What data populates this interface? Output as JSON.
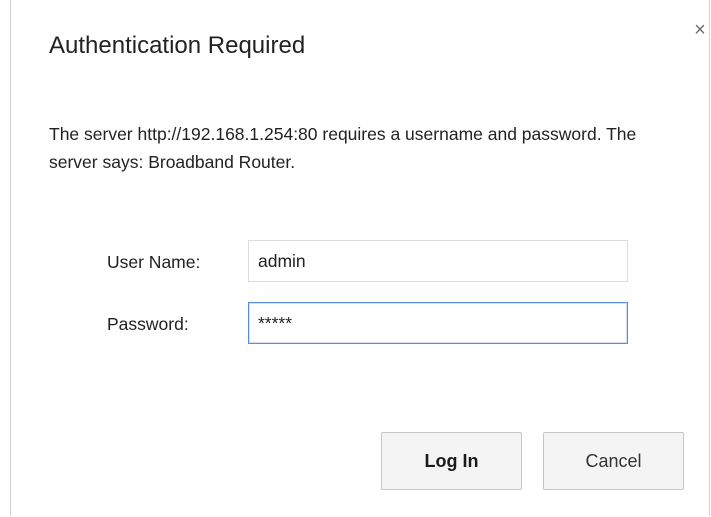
{
  "dialog": {
    "title": "Authentication Required",
    "close_glyph": "×",
    "message": "The server http://192.168.1.254:80 requires a username and password. The server says: Broadband Router.",
    "username": {
      "label": "User Name:",
      "value": "admin"
    },
    "password": {
      "label": "Password:",
      "value": "*****"
    },
    "buttons": {
      "login": "Log In",
      "cancel": "Cancel"
    }
  },
  "colors": {
    "focus_border": "#5b8fd9",
    "button_bg": "#f4f4f4"
  }
}
